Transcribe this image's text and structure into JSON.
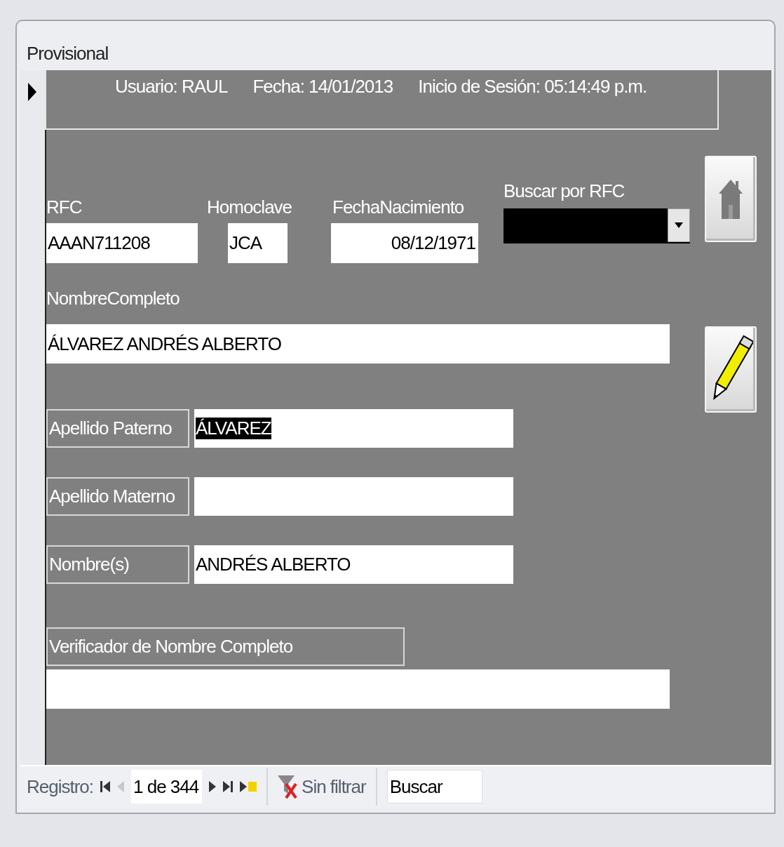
{
  "window": {
    "title": "Provisional"
  },
  "header": {
    "user": "Usuario: RAUL",
    "date": "Fecha: 14/01/2013",
    "session": "Inicio de Sesión: 05:14:49 p.m."
  },
  "top_fields": [
    {
      "kind": "text",
      "label": "RFC",
      "value": "AAAN711208"
    },
    {
      "kind": "code",
      "label": "Homoclave",
      "value": "JCA"
    },
    {
      "kind": "date",
      "label": "FechaNacimiento",
      "value": "08/12/1971"
    }
  ],
  "search_rfc": {
    "label": "Buscar por RFC"
  },
  "full_name": {
    "label": "NombreCompleto",
    "value": "ÁLVAREZ ANDRÉS ALBERTO"
  },
  "name_parts": [
    {
      "label": "Apellido Paterno",
      "value": "ÁLVAREZ",
      "highlighted": true
    },
    {
      "label": "Apellido Materno",
      "highlighted": false
    },
    {
      "label": "Nombre(s)",
      "value": "ANDRÉS ALBERTO",
      "highlighted": false
    }
  ],
  "verifier": {
    "label": "Verificador de Nombre Completo"
  },
  "navigation": {
    "label": "Registro:",
    "position": "1 de 344",
    "filter": "Sin filtrar",
    "search_placeholder": "Buscar"
  }
}
